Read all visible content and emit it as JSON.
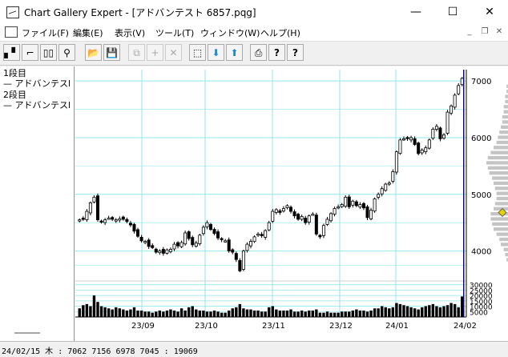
{
  "window": {
    "title": "Chart Gallery Expert - [アドバンテスト 6857.pqg]",
    "minimize": "—",
    "maximize": "☐",
    "close": "✕"
  },
  "menu": {
    "items": [
      "ファイル(F)",
      "編集(E)",
      "表示(V)",
      "ツール(T)",
      "ウィンドウ(W)",
      "ヘルプ(H)"
    ],
    "mdi_minimize": "_",
    "mdi_restore": "❐",
    "mdi_close": "✕"
  },
  "toolbar": {
    "buttons": [
      {
        "icon": "candle-chart-icon",
        "glyph": "▖▘"
      },
      {
        "icon": "step-chart-icon",
        "glyph": "⌐"
      },
      {
        "icon": "dual-pane-icon",
        "glyph": "▯▯"
      },
      {
        "icon": "binoculars-icon",
        "glyph": "⚲"
      },
      {
        "icon": "open-folder-icon",
        "glyph": "📂"
      },
      {
        "icon": "save-icon",
        "glyph": "💾"
      },
      {
        "icon": "copy-icon",
        "glyph": "⧉"
      },
      {
        "icon": "plus-icon",
        "glyph": "+"
      },
      {
        "icon": "delete-icon",
        "glyph": "✕"
      },
      {
        "icon": "select-icon",
        "glyph": "⬚"
      },
      {
        "icon": "arrow-down-icon",
        "glyph": "⬇"
      },
      {
        "icon": "arrow-up-icon",
        "glyph": "⬆"
      },
      {
        "icon": "print-icon",
        "glyph": "⎙"
      },
      {
        "icon": "help-icon",
        "glyph": "?"
      },
      {
        "icon": "context-help-icon",
        "glyph": "?"
      }
    ]
  },
  "legend": {
    "pane1_title": "1段目",
    "pane1_series": "— アドバンテスl",
    "pane2_title": "2段目",
    "pane2_series": "— アドバンテスl"
  },
  "chart_data": {
    "type": "candlestick",
    "price_ylim": [
      3500,
      7200
    ],
    "price_ticks": [
      4000,
      5000,
      6000,
      7000
    ],
    "volume_ticks": [
      5000,
      10000,
      15000,
      20000,
      25000,
      30000
    ],
    "x_labels": [
      "23/09",
      "23/10",
      "23/11",
      "23/12",
      "24/01",
      "24/02"
    ],
    "grid": true,
    "colors": {
      "grid": "#8fe6ee",
      "candle": "#000000",
      "cursor": "#00008b",
      "marker": "#e8d000"
    },
    "close": [
      4550,
      4560,
      4700,
      4850,
      4950,
      4550,
      4520,
      4550,
      4580,
      4560,
      4550,
      4570,
      4560,
      4520,
      4460,
      4350,
      4260,
      4180,
      4170,
      4080,
      4060,
      3980,
      4000,
      3960,
      4020,
      4030,
      4120,
      4090,
      4150,
      4320,
      4220,
      4110,
      4140,
      4280,
      4420,
      4500,
      4380,
      4310,
      4230,
      4200,
      4180,
      4000,
      3980,
      3850,
      3650,
      4000,
      4120,
      4170,
      4250,
      4300,
      4270,
      4360,
      4500,
      4700,
      4730,
      4680,
      4750,
      4800,
      4700,
      4620,
      4560,
      4610,
      4500,
      4620,
      4650,
      4300,
      4250,
      4450,
      4560,
      4660,
      4750,
      4780,
      4820,
      4950,
      4780,
      4880,
      4800,
      4820,
      4760,
      4590,
      4720,
      4920,
      5000,
      5100,
      5180,
      5200,
      5400,
      5750,
      5960,
      5980,
      5980,
      6000,
      5880,
      5720,
      5780,
      5820,
      5960,
      6150,
      6200,
      5980,
      6050,
      6450,
      6560,
      6750,
      6920,
      7045
    ],
    "volume": [
      8000,
      11000,
      12000,
      10000,
      20000,
      14000,
      10000,
      9000,
      8000,
      7000,
      9000,
      8000,
      7000,
      6000,
      7000,
      9000,
      6000,
      6000,
      5000,
      5000,
      4000,
      5000,
      6000,
      5000,
      6000,
      7000,
      6000,
      5000,
      8000,
      6000,
      9000,
      10000,
      7000,
      6000,
      6000,
      5000,
      5000,
      6000,
      5000,
      4000,
      4000,
      6000,
      8000,
      9000,
      12000,
      8000,
      7000,
      7000,
      6000,
      6000,
      5000,
      5000,
      9000,
      10000,
      7000,
      6000,
      6000,
      6000,
      7000,
      5000,
      5000,
      6000,
      5000,
      6000,
      6000,
      7000,
      4000,
      4000,
      5000,
      4000,
      4000,
      4000,
      5000,
      5000,
      5000,
      6000,
      7000,
      6000,
      6000,
      5000,
      6000,
      8000,
      8000,
      10000,
      9000,
      8000,
      9000,
      13000,
      12000,
      11000,
      10000,
      9000,
      8000,
      7000,
      9000,
      10000,
      11000,
      12000,
      10000,
      9000,
      10000,
      11000,
      13000,
      12000,
      9000,
      19069
    ],
    "last": {
      "date": "24/02/15",
      "day": "木",
      "open": 7062,
      "high": 7156,
      "low": 6978,
      "close": 7045,
      "volume": 19069
    }
  },
  "status": {
    "text": "24/02/15 木 : 7062 7156 6978 7045 : 19069"
  }
}
